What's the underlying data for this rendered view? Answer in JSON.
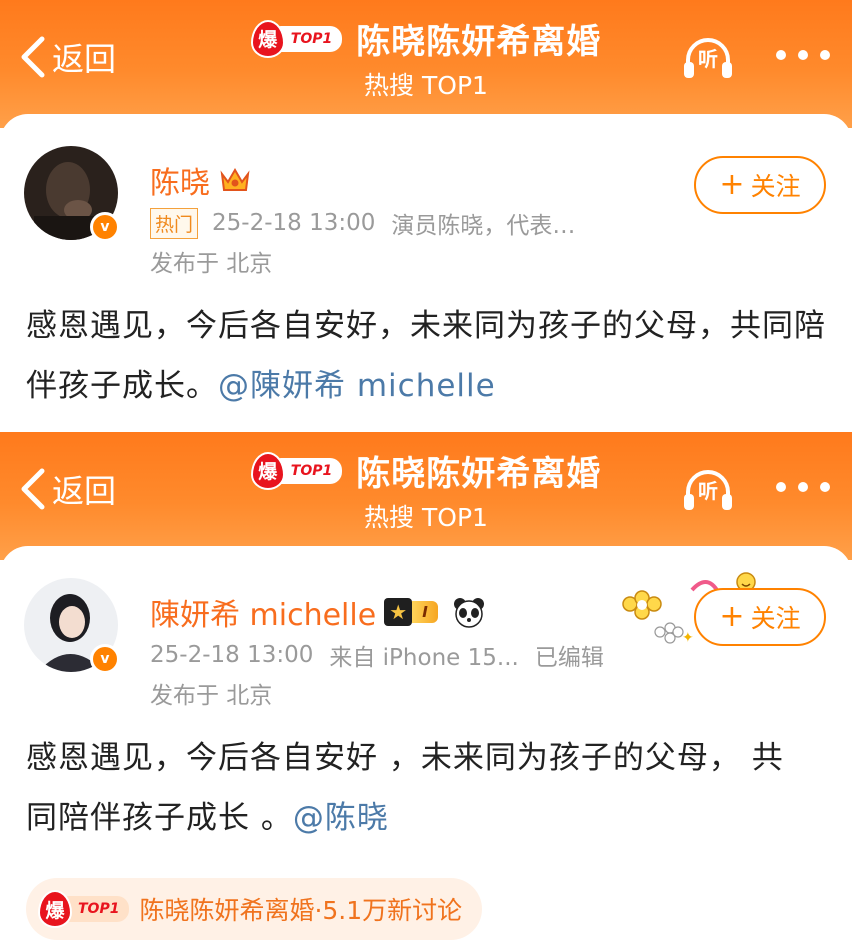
{
  "colors": {
    "header_orange": "#ff7a1c",
    "name_orange": "#f86d1e",
    "mention_blue": "#4c7aa8",
    "follow_orange": "#ff8200",
    "hot_red": "#e8141e"
  },
  "header": {
    "back_label": "返回",
    "bao_char": "爆",
    "top1_tag": "TOP1",
    "topic_title": "陈晓陈妍希离婚",
    "subtitle": "热搜 TOP1",
    "listen_label": "听",
    "icons": {
      "back": "chevron-left-icon",
      "listen": "headphones-icon",
      "more": "more-dots-icon"
    }
  },
  "posts": [
    {
      "user_name": "陈晓",
      "verified_mark": "v",
      "hot_tag": "热门",
      "time": "25-2-18 13:00",
      "source": "演员陈晓，代表…",
      "location": "发布于 北京",
      "follow_label": "关注",
      "follow_plus": "+",
      "text": "感恩遇见，今后各自安好，未来同为孩子的父母，共同陪伴孩子成长。",
      "mention": "@陳妍希 michelle",
      "icons": {
        "badge": "crown-icon"
      }
    },
    {
      "user_name": "陳妍希 michelle",
      "verified_mark": "v",
      "level_tag": "I",
      "time": "25-2-18 13:00",
      "source": "来自 iPhone 15...",
      "edited": "已编辑",
      "location": "发布于 北京",
      "follow_label": "关注",
      "follow_plus": "+",
      "text": "感恩遇见，今后各自安好 ，未来同为孩子的父母， 共同陪伴孩子成长 。",
      "mention": "@陈晓",
      "icons": {
        "badge": "member-star-icon",
        "panda": "panda-icon",
        "decoration": "flower-sticker-icon"
      }
    }
  ],
  "hot_pill": {
    "bao_char": "爆",
    "top1_tag": "TOP1",
    "text": "陈晓陈妍希离婚·5.1万新讨论"
  }
}
